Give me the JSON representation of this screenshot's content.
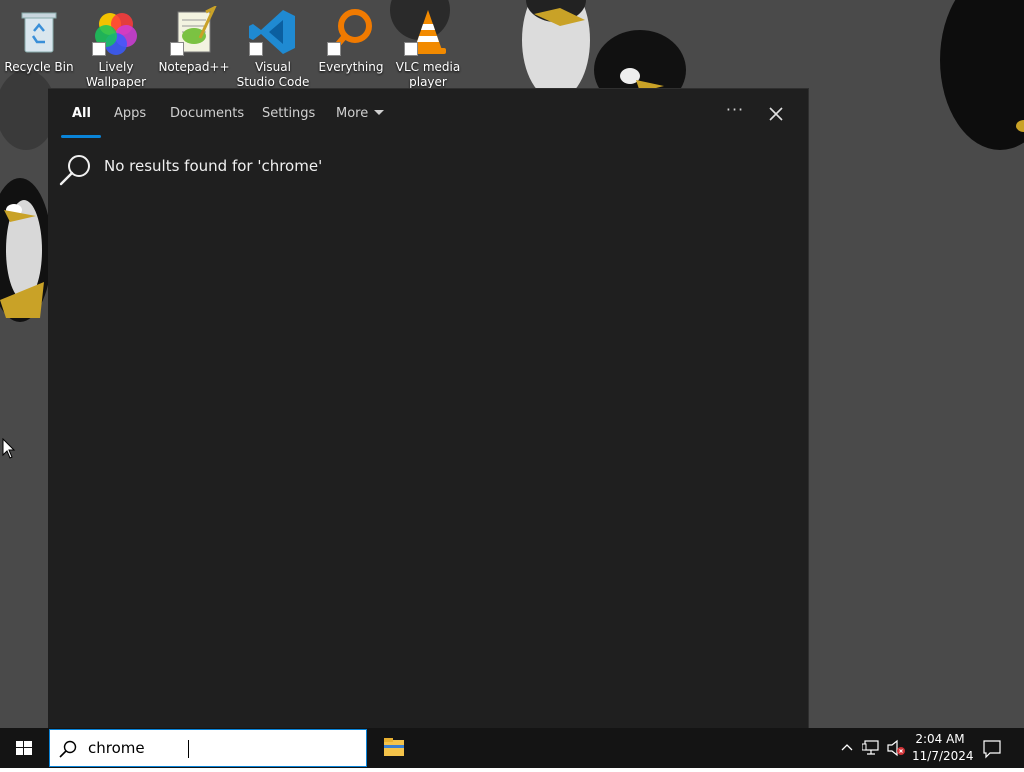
{
  "desktop": {
    "icons": [
      {
        "label": "Recycle Bin"
      },
      {
        "label": "Lively Wallpaper"
      },
      {
        "label": "Notepad++"
      },
      {
        "label": "Visual Studio Code"
      },
      {
        "label": "Everything"
      },
      {
        "label": "VLC media player"
      }
    ]
  },
  "search_panel": {
    "tabs": [
      {
        "label": "All",
        "active": true
      },
      {
        "label": "Apps"
      },
      {
        "label": "Documents"
      },
      {
        "label": "Settings"
      },
      {
        "label": "More"
      }
    ],
    "options_label": "···",
    "no_results_text": "No results found for 'chrome'"
  },
  "taskbar": {
    "search_value": "chrome",
    "clock": {
      "time": "2:04 AM",
      "date": "11/7/2024"
    }
  },
  "colors": {
    "accent": "#0a84d8",
    "panel_bg": "#1f1f1f",
    "taskbar_bg": "#141414"
  }
}
